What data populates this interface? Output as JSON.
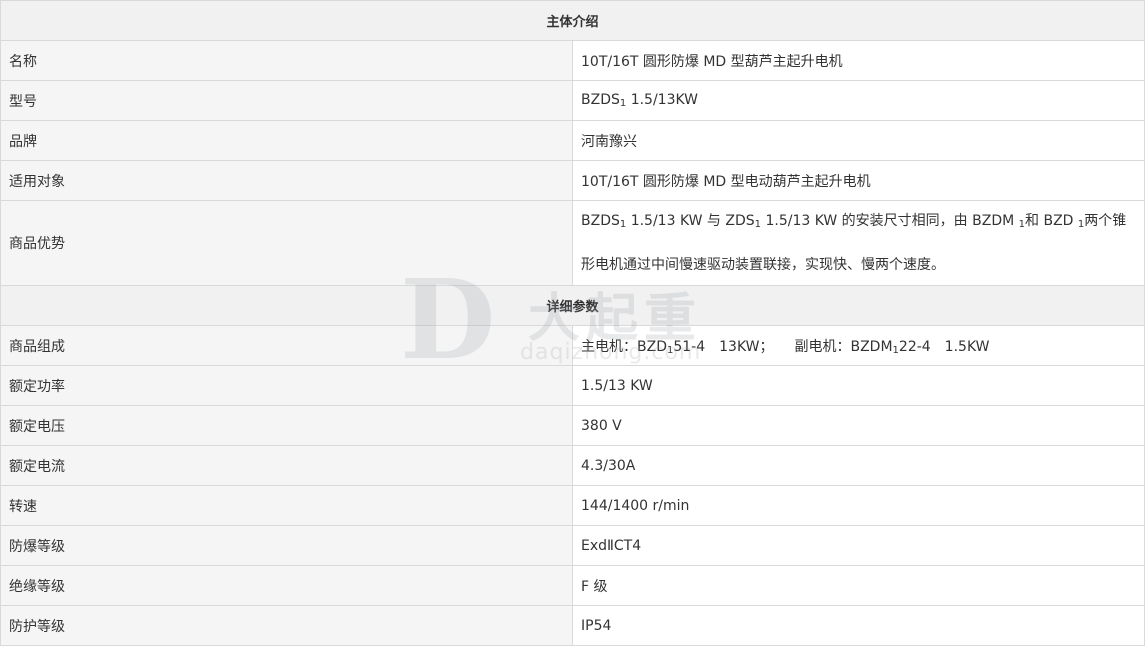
{
  "sections": {
    "main_title": "主体介绍",
    "detail_title": "详细参数"
  },
  "main_rows": [
    {
      "label": "名称",
      "value": "10T/16T 圆形防爆 MD 型葫芦主起升电机"
    },
    {
      "label": "型号",
      "value_pre": "BZDS",
      "value_sub": "1",
      "value_post": " 1.5/13KW"
    },
    {
      "label": "品牌",
      "value": "河南豫兴"
    },
    {
      "label": "适用对象",
      "value": "10T/16T 圆形防爆 MD 型电动葫芦主起升电机"
    },
    {
      "label": "商品优势",
      "value_parts": [
        "BZDS",
        "1",
        " 1.5/13 KW 与 ZDS",
        "1",
        " 1.5/13 KW 的安装尺寸相同，由 BZDM ",
        "1",
        "和 BZD ",
        "1",
        "两个锥形电机通过中间慢速驱动装置联接，实现快、慢两个速度。"
      ]
    }
  ],
  "detail_rows": [
    {
      "label": "商品组成",
      "value_parts": [
        "主电机：BZD",
        "1",
        "51-4　13KW；　　副电机：BZDM",
        "1",
        "22-4　1.5KW"
      ]
    },
    {
      "label": "额定功率",
      "value": "1.5/13 KW"
    },
    {
      "label": "额定电压",
      "value": "380 V"
    },
    {
      "label": "额定电流",
      "value": "4.3/30A"
    },
    {
      "label": "转速",
      "value": "144/1400 r/min"
    },
    {
      "label": "防爆等级",
      "value": "ExdⅡCT4"
    },
    {
      "label": "绝缘等级",
      "value": "F 级"
    },
    {
      "label": "防护等级",
      "value": "IP54"
    }
  ],
  "watermark": {
    "logo_letter": "D",
    "chinese": "大起重",
    "domain": "daqizhong.com"
  }
}
